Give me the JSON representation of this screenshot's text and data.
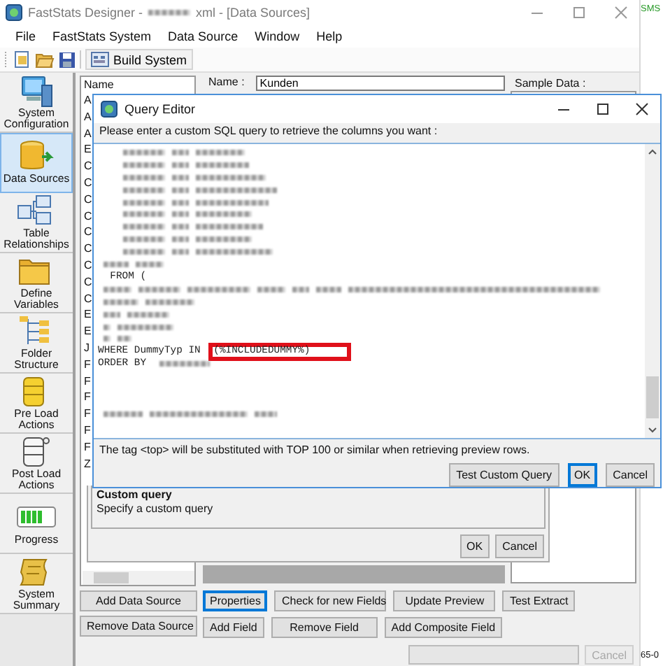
{
  "window": {
    "title_start": "FastStats Designer -",
    "title_end": "xml - [Data Sources]"
  },
  "menu": [
    "File",
    "FastStats System",
    "Data Source",
    "Window",
    "Help"
  ],
  "toolbar": {
    "build_label": "Build System"
  },
  "nav": [
    {
      "label": "System Configuration",
      "selected": false
    },
    {
      "label": "Data Sources",
      "selected": true
    },
    {
      "label": "Table Relationships",
      "selected": false
    },
    {
      "label": "Define Variables",
      "selected": false
    },
    {
      "label": "Folder Structure",
      "selected": false
    },
    {
      "label": "Pre Load Actions",
      "selected": false
    },
    {
      "label": "Post Load Actions",
      "selected": false
    },
    {
      "label": "Progress",
      "selected": false
    },
    {
      "label": "System Summary",
      "selected": false
    }
  ],
  "data_sources": {
    "header": "Name",
    "items": [
      "A",
      "A",
      "A",
      "E",
      "C",
      "C",
      "C",
      "C",
      "C",
      "C",
      "C",
      "C",
      "C",
      "E",
      "E",
      "J",
      "F",
      "F",
      "F",
      "F",
      "F",
      "F",
      "Z"
    ],
    "buttons": [
      "Add Data Source",
      "Remove Data Source"
    ]
  },
  "source_form": {
    "name_label": "Name :",
    "name_value": "Kunden",
    "sample_label": "Sample Data :"
  },
  "field_buttons": [
    [
      {
        "label": "Properties",
        "focused": true
      },
      {
        "label": "Check for new Fields",
        "focused": false
      },
      {
        "label": "Update Preview",
        "focused": false
      },
      {
        "label": "Test Extract",
        "focused": false
      }
    ],
    [
      {
        "label": "Add Field",
        "focused": false
      },
      {
        "label": "Remove Field",
        "focused": false
      },
      {
        "label": "Add Composite Field",
        "focused": false
      }
    ]
  ],
  "custom_query_dialog": {
    "title": "Custom query",
    "description": "Specify a custom query",
    "buttons": [
      "OK",
      "Cancel"
    ]
  },
  "query_editor": {
    "title": "Query Editor",
    "instruction": "Please enter a custom SQL query to retrieve the columns you want :",
    "lines": [
      {
        "kind": "blurred"
      },
      {
        "kind": "blurred"
      },
      {
        "kind": "blurred"
      },
      {
        "kind": "blurred"
      },
      {
        "kind": "blurred"
      },
      {
        "kind": "blurred"
      },
      {
        "kind": "blurred"
      },
      {
        "kind": "blurred"
      },
      {
        "kind": "blurred"
      },
      {
        "kind": "blurred"
      },
      {
        "kind": "code",
        "text": "  FROM ("
      },
      {
        "kind": "blurred"
      },
      {
        "kind": "blurred"
      },
      {
        "kind": "blurred"
      },
      {
        "kind": "blurred"
      },
      {
        "kind": "blurred"
      },
      {
        "kind": "code",
        "text": "WHERE DummyTyp IN ",
        "highlight": "(%INCLUDEDUMMY%)"
      },
      {
        "kind": "code",
        "text": "ORDER BY ",
        "blurred_tail": true
      },
      {
        "kind": "blank"
      },
      {
        "kind": "blank"
      },
      {
        "kind": "blank"
      },
      {
        "kind": "blurred"
      },
      {
        "kind": "blank"
      }
    ],
    "note": "The tag <top> will be substituted with TOP 100 or similar when retrieving preview rows.",
    "buttons": [
      {
        "label": "Test Custom Query",
        "default": false
      },
      {
        "label": "OK",
        "default": true
      },
      {
        "label": "Cancel",
        "default": false
      }
    ]
  },
  "status_bar": {
    "cancel": {
      "label": "Cancel",
      "disabled": true
    }
  },
  "side_window": {
    "top_text": "SMS",
    "bottom_text": "65-0"
  }
}
